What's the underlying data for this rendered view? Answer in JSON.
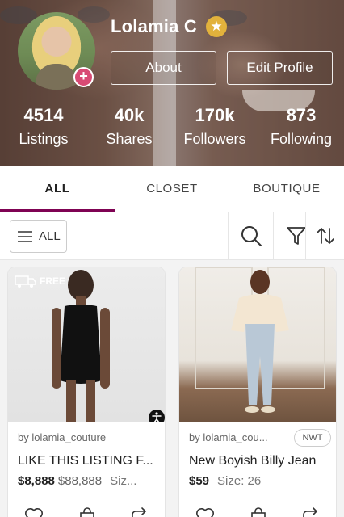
{
  "profile": {
    "username": "Lolamia C",
    "star_badge": "★",
    "avatar_plus": "+",
    "about_label": "About",
    "edit_profile_label": "Edit Profile"
  },
  "stats": [
    {
      "value": "4514",
      "label": "Listings"
    },
    {
      "value": "40k",
      "label": "Shares"
    },
    {
      "value": "170k",
      "label": "Followers"
    },
    {
      "value": "873",
      "label": "Following"
    }
  ],
  "tabs": [
    {
      "label": "ALL",
      "active": true
    },
    {
      "label": "CLOSET",
      "active": false
    },
    {
      "label": "BOUTIQUE",
      "active": false
    }
  ],
  "filter": {
    "all_label": "ALL",
    "icons": [
      "search-icon",
      "filter-icon",
      "sort-icon"
    ]
  },
  "listings": [
    {
      "seller": "by lolamia_couture",
      "title": "LIKE THIS LISTING F...",
      "price": "$8,888",
      "original_price": "$88,888",
      "size": "Siz...",
      "badge": "FREE",
      "condition": ""
    },
    {
      "seller": "by lolamia_cou...",
      "title": "New Boyish Billy Jean",
      "price": "$59",
      "original_price": "",
      "size": "Size: 26",
      "badge": "",
      "condition": "NWT"
    }
  ],
  "colors": {
    "accent": "#7f0353",
    "star": "#e2b23c",
    "plus": "#d84a74"
  }
}
